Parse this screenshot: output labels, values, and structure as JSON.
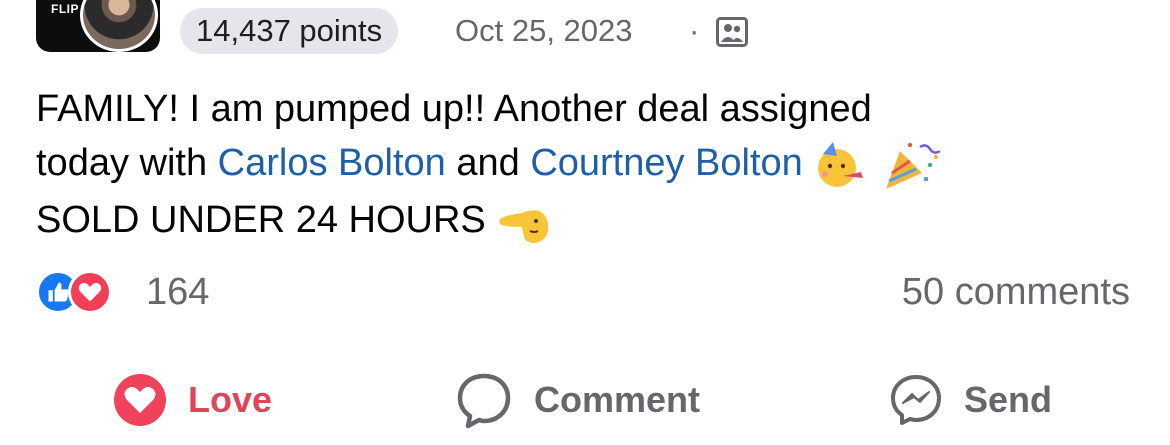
{
  "header": {
    "group_logo_text": "FLIP",
    "points": "14,437 points",
    "date": "Oct 25, 2023",
    "separator": "·",
    "audience_icon": "group-members-icon"
  },
  "post": {
    "line1": "FAMILY! I am pumped up!! Another deal assigned",
    "line2_prefix": "today with ",
    "mention1": "Carlos Bolton",
    "line2_mid": " and ",
    "mention2": "Courtney Bolton",
    "line3": "SOLD UNDER 24 HOURS",
    "emojis": [
      "partying-face",
      "party-popper",
      "backhand-index-pointing-left"
    ]
  },
  "engagement": {
    "reaction_icons": [
      "like",
      "love"
    ],
    "reaction_count": "164",
    "comments_count": "50 comments"
  },
  "actions": {
    "love_label": "Love",
    "comment_label": "Comment",
    "send_label": "Send"
  },
  "colors": {
    "mention": "#1d5fa8",
    "love": "#e0455a",
    "like_blue": "#1877f2",
    "muted": "#65676b",
    "badge_bg": "#e4e6eb"
  }
}
